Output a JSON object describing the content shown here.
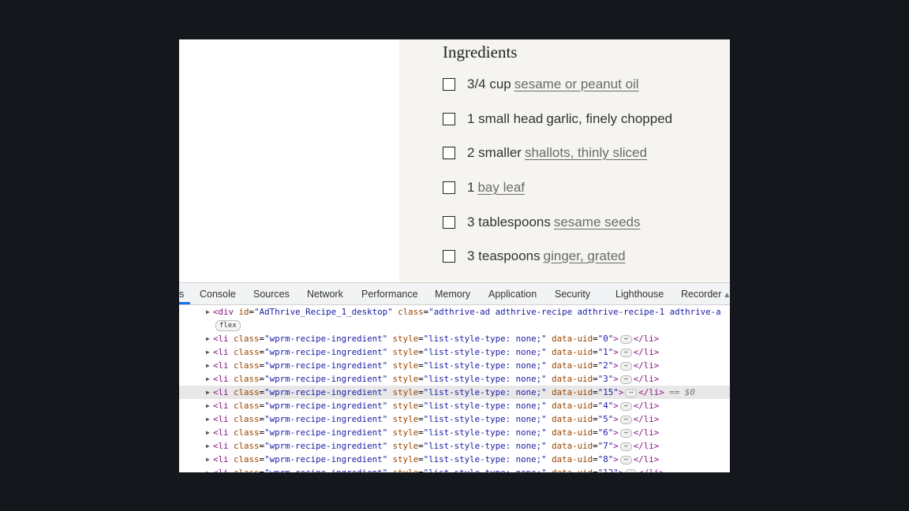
{
  "ingredients": {
    "title": "Ingredients",
    "items": [
      {
        "qty": "3/4 cup",
        "name": "sesame or peanut oil",
        "linked": true
      },
      {
        "qty": "1 small head",
        "name": "garlic, finely chopped",
        "linked": false
      },
      {
        "qty": "2 smaller",
        "name": "shallots, thinly sliced",
        "linked": true
      },
      {
        "qty": "1",
        "name": "bay leaf",
        "linked": true
      },
      {
        "qty": "3 tablespoons",
        "name": "sesame seeds",
        "linked": true
      },
      {
        "qty": "3 teaspoons",
        "name": "ginger, grated",
        "linked": true
      }
    ]
  },
  "devtools": {
    "tabs": [
      "s",
      "Console",
      "Sources",
      "Network",
      "Performance",
      "Memory",
      "Application",
      "Security",
      "Lighthouse",
      "Recorder"
    ],
    "div_line": {
      "open": "<div",
      "id_attr": "id",
      "id_val": "\"AdThrive_Recipe_1_desktop\"",
      "class_attr": "class",
      "class_val": "\"adthrive-ad adthrive-recipe adthrive-recipe-1 adthrive-a"
    },
    "flex_badge": "flex",
    "li_open": "<li",
    "li_class_attr": "class",
    "li_class_val": "\"wprm-recipe-ingredient\"",
    "li_style_attr": "style",
    "li_style_val": "\"list-style-type: none;\"",
    "li_uid_attr": "data-uid",
    "li_close": "</li>",
    "ellipsis": "⋯",
    "selected_marker": "== $0",
    "uids": [
      "0",
      "1",
      "2",
      "3",
      "15",
      "4",
      "5",
      "6",
      "7",
      "8",
      "12"
    ],
    "selected_index": 4
  }
}
